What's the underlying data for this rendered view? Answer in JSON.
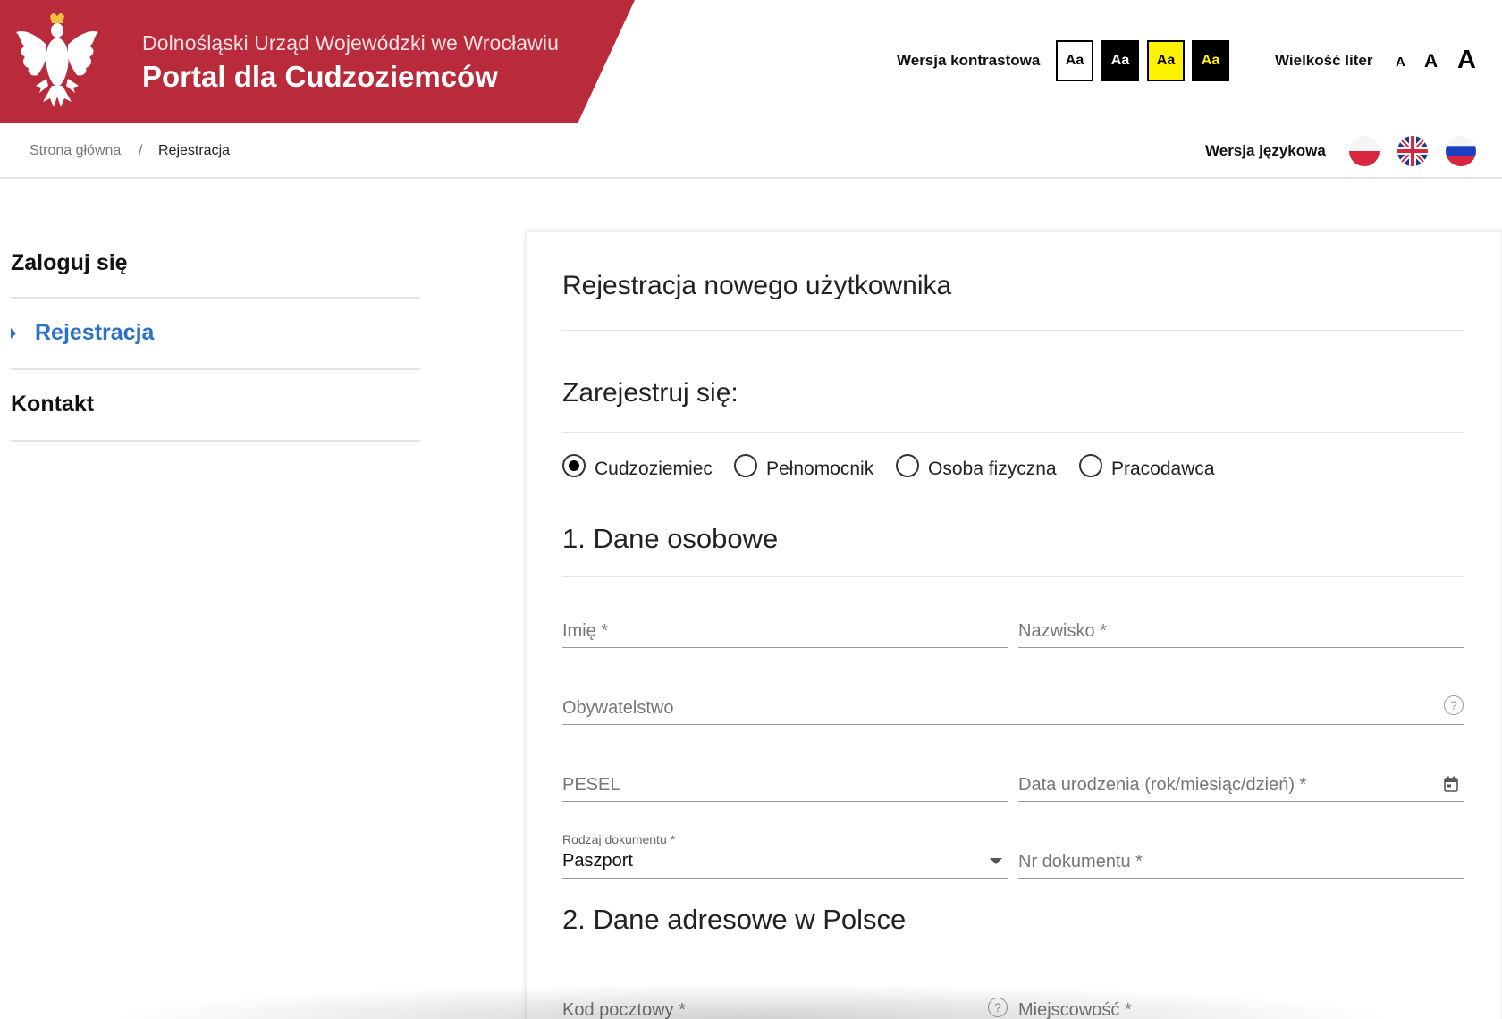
{
  "header": {
    "office_name": "Dolnośląski Urząd Wojewódzki we Wrocławiu",
    "portal_name": "Portal dla Cudzoziemców",
    "contrast_label": "Wersja kontrastowa",
    "contrast_options": [
      "Aa",
      "Aa",
      "Aa",
      "Aa"
    ],
    "font_size_label": "Wielkość liter",
    "font_sizes": [
      "A",
      "A",
      "A"
    ]
  },
  "breadcrumb": {
    "home": "Strona główna",
    "separator": "/",
    "current": "Rejestracja"
  },
  "language": {
    "label": "Wersja językowa"
  },
  "sidebar": {
    "items": [
      {
        "label": "Zaloguj się"
      },
      {
        "label": "Rejestracja"
      },
      {
        "label": "Kontakt"
      }
    ]
  },
  "main": {
    "title": "Rejestracja nowego użytkownika",
    "register_heading": "Zarejestruj się:",
    "account_types": [
      "Cudzoziemiec",
      "Pełnomocnik",
      "Osoba fizyczna",
      "Pracodawca"
    ],
    "section1_heading": "1. Dane osobowe",
    "fields": {
      "first_name": "Imię *",
      "last_name": "Nazwisko *",
      "citizenship": "Obywatelstwo",
      "pesel": "PESEL",
      "birth_date": "Data urodzenia (rok/miesiąc/dzień) *",
      "document_type_label": "Rodzaj dokumentu *",
      "document_type_value": "Paszport",
      "document_number": "Nr dokumentu *"
    },
    "section2_heading": "2. Dane adresowe w Polsce",
    "fields2": {
      "postal_code": "Kod pocztowy *",
      "city": "Miejscowość *"
    },
    "help_glyph": "?"
  },
  "colors": {
    "brand_red": "#b92b3a",
    "link_blue": "#2a72c6",
    "contrast_yellow": "#fff200"
  }
}
